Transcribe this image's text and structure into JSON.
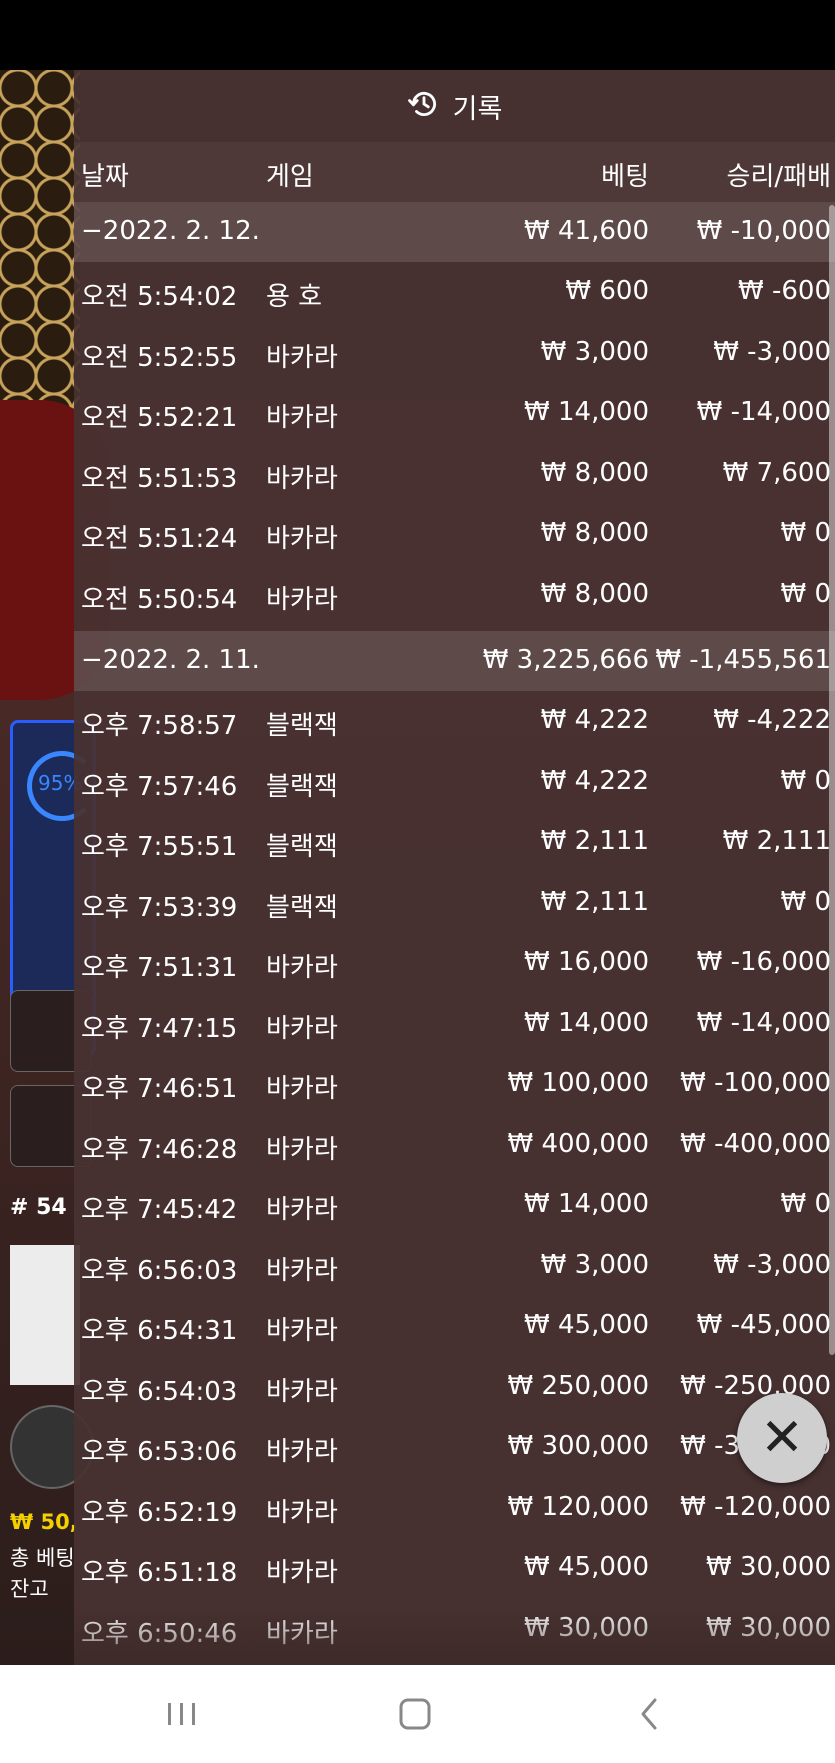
{
  "dialog": {
    "title": "기록",
    "headers": {
      "date": "날짜",
      "game": "게임",
      "bet": "베팅",
      "winloss": "승리/패배"
    },
    "groups": [
      {
        "date": "−2022. 2. 12.",
        "bet_total": "₩ 41,600",
        "winloss_total": "₩ -10,000",
        "rows": [
          {
            "time": "오전 5:54:02",
            "game": "용 호",
            "bet": "₩ 600",
            "winloss": "₩ -600"
          },
          {
            "time": "오전 5:52:55",
            "game": "바카라",
            "bet": "₩ 3,000",
            "winloss": "₩ -3,000"
          },
          {
            "time": "오전 5:52:21",
            "game": "바카라",
            "bet": "₩ 14,000",
            "winloss": "₩ -14,000"
          },
          {
            "time": "오전 5:51:53",
            "game": "바카라",
            "bet": "₩ 8,000",
            "winloss": "₩ 7,600"
          },
          {
            "time": "오전 5:51:24",
            "game": "바카라",
            "bet": "₩ 8,000",
            "winloss": "₩ 0"
          },
          {
            "time": "오전 5:50:54",
            "game": "바카라",
            "bet": "₩ 8,000",
            "winloss": "₩ 0"
          }
        ]
      },
      {
        "date": "−2022. 2. 11.",
        "bet_total": "₩ 3,225,666",
        "winloss_total": "₩ -1,455,561",
        "rows": [
          {
            "time": "오후 7:58:57",
            "game": "블랙잭",
            "bet": "₩ 4,222",
            "winloss": "₩ -4,222"
          },
          {
            "time": "오후 7:57:46",
            "game": "블랙잭",
            "bet": "₩ 4,222",
            "winloss": "₩ 0"
          },
          {
            "time": "오후 7:55:51",
            "game": "블랙잭",
            "bet": "₩ 2,111",
            "winloss": "₩ 2,111"
          },
          {
            "time": "오후 7:53:39",
            "game": "블랙잭",
            "bet": "₩ 2,111",
            "winloss": "₩ 0"
          },
          {
            "time": "오후 7:51:31",
            "game": "바카라",
            "bet": "₩ 16,000",
            "winloss": "₩ -16,000"
          },
          {
            "time": "오후 7:47:15",
            "game": "바카라",
            "bet": "₩ 14,000",
            "winloss": "₩ -14,000"
          },
          {
            "time": "오후 7:46:51",
            "game": "바카라",
            "bet": "₩ 100,000",
            "winloss": "₩ -100,000"
          },
          {
            "time": "오후 7:46:28",
            "game": "바카라",
            "bet": "₩ 400,000",
            "winloss": "₩ -400,000"
          },
          {
            "time": "오후 7:45:42",
            "game": "바카라",
            "bet": "₩ 14,000",
            "winloss": "₩ 0"
          },
          {
            "time": "오후 6:56:03",
            "game": "바카라",
            "bet": "₩ 3,000",
            "winloss": "₩ -3,000"
          },
          {
            "time": "오후 6:54:31",
            "game": "바카라",
            "bet": "₩ 45,000",
            "winloss": "₩ -45,000"
          },
          {
            "time": "오후 6:54:03",
            "game": "바카라",
            "bet": "₩ 250,000",
            "winloss": "₩ -250,000"
          },
          {
            "time": "오후 6:53:06",
            "game": "바카라",
            "bet": "₩ 300,000",
            "winloss": "₩ -300,000"
          },
          {
            "time": "오후 6:52:19",
            "game": "바카라",
            "bet": "₩ 120,000",
            "winloss": "₩ -120,000"
          },
          {
            "time": "오후 6:51:18",
            "game": "바카라",
            "bet": "₩ 45,000",
            "winloss": "₩ 30,000"
          },
          {
            "time": "오후 6:50:46",
            "game": "바카라",
            "bet": "₩ 30,000",
            "winloss": "₩ 30,000"
          }
        ]
      }
    ]
  },
  "background": {
    "progress_label": "95%",
    "round_label": "# 54",
    "balance_line": "₩ 50,",
    "total_bet_label": "총 베팅",
    "balance_label": "잔고"
  },
  "colors": {
    "overlay": "#4a3232",
    "accent_blue": "#3a86ff",
    "gold": "#f5d000"
  },
  "icons": {
    "history": "history-icon",
    "close": "close-icon",
    "recents": "recents-icon",
    "home": "home-icon",
    "back": "back-icon"
  }
}
